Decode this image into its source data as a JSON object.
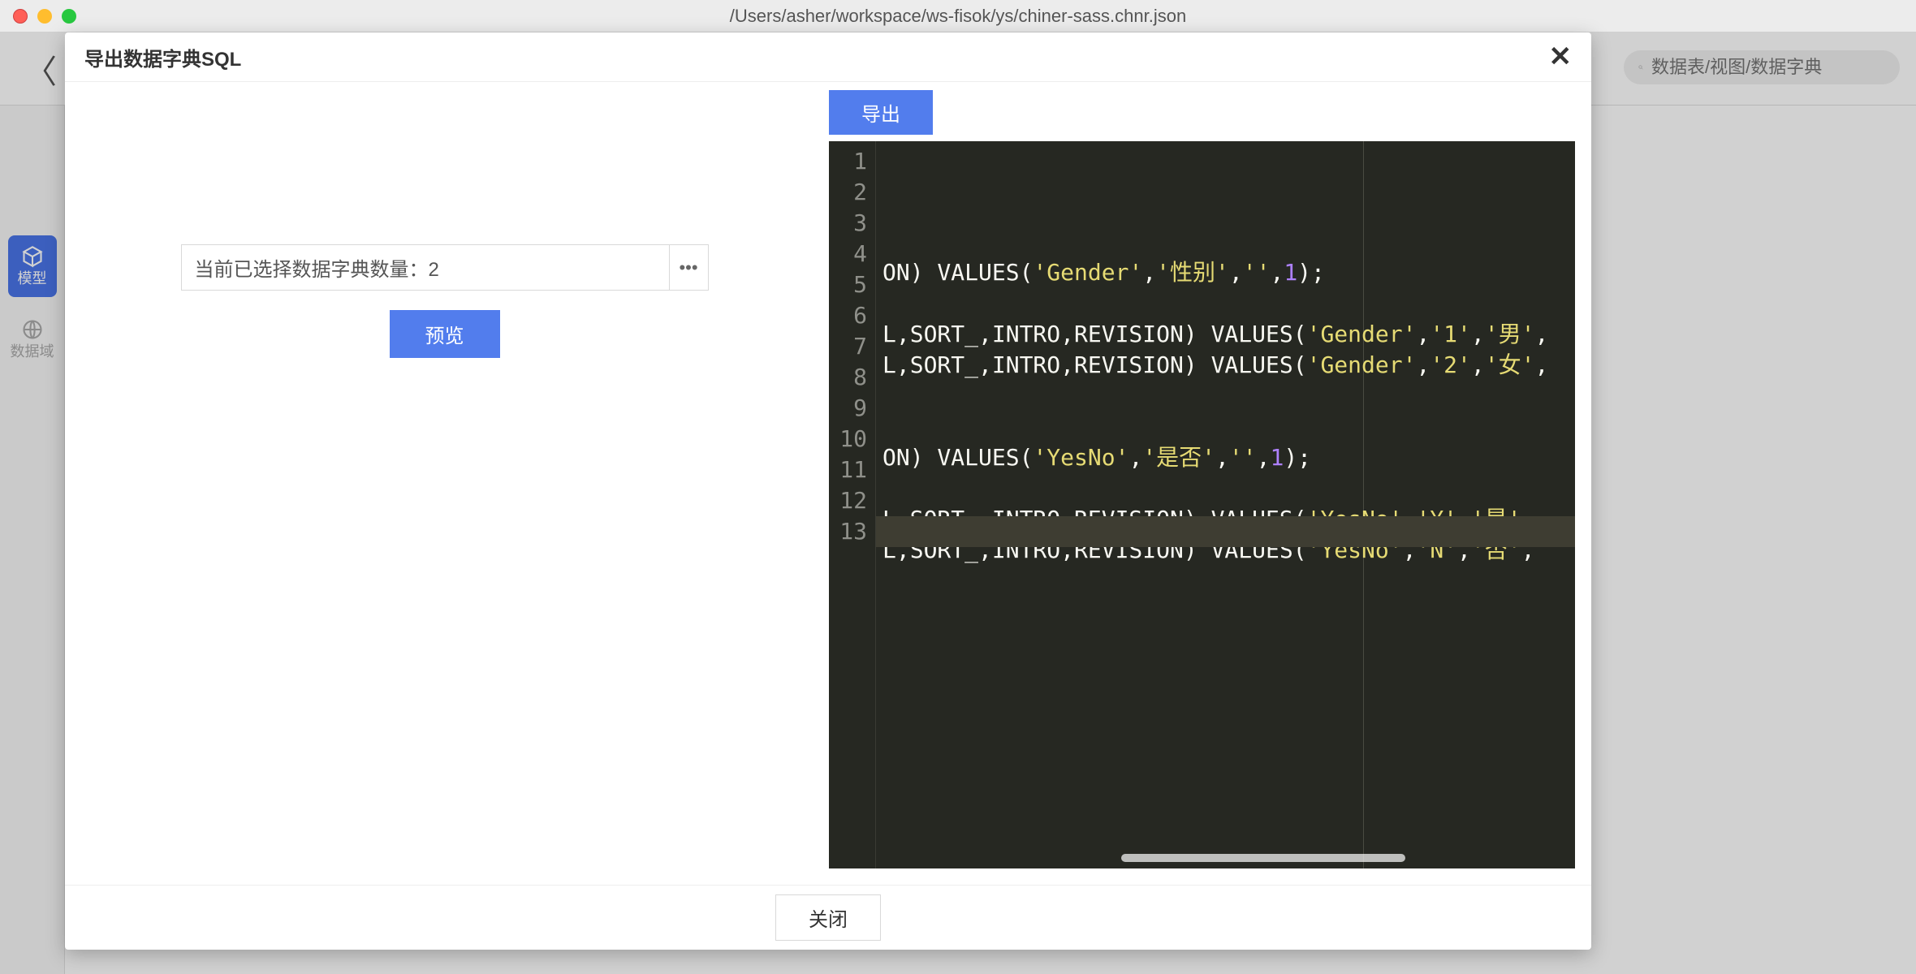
{
  "window": {
    "title": "/Users/asher/workspace/ws-fisok/ys/chiner-sass.chnr.json"
  },
  "toolbar": {
    "search_placeholder": "数据表/视图/数据字典"
  },
  "sidebar": {
    "items": [
      {
        "label": "模型"
      },
      {
        "label": "数据域"
      }
    ]
  },
  "modal": {
    "title": "导出数据字典SQL",
    "count_label": "当前已选择数据字典数量：",
    "count_value": "2",
    "preview_label": "预览",
    "export_label": "导出",
    "close_label": "关闭"
  },
  "code": {
    "current_line": 13,
    "lines": [
      {
        "n": 1,
        "segments": []
      },
      {
        "n": 2,
        "segments": [
          {
            "t": "ON) VALUES(",
            "c": "default"
          },
          {
            "t": "'Gender'",
            "c": "str"
          },
          {
            "t": ",",
            "c": "punc"
          },
          {
            "t": "'性别'",
            "c": "str"
          },
          {
            "t": ",",
            "c": "punc"
          },
          {
            "t": "''",
            "c": "str"
          },
          {
            "t": ",",
            "c": "punc"
          },
          {
            "t": "1",
            "c": "num"
          },
          {
            "t": ");",
            "c": "punc"
          }
        ]
      },
      {
        "n": 3,
        "segments": []
      },
      {
        "n": 4,
        "segments": [
          {
            "t": "L,SORT_,INTRO,REVISION) VALUES(",
            "c": "default"
          },
          {
            "t": "'Gender'",
            "c": "str"
          },
          {
            "t": ",",
            "c": "punc"
          },
          {
            "t": "'1'",
            "c": "str"
          },
          {
            "t": ",",
            "c": "punc"
          },
          {
            "t": "'男'",
            "c": "str"
          },
          {
            "t": ",",
            "c": "punc"
          }
        ]
      },
      {
        "n": 5,
        "segments": [
          {
            "t": "L,SORT_,INTRO,REVISION) VALUES(",
            "c": "default"
          },
          {
            "t": "'Gender'",
            "c": "str"
          },
          {
            "t": ",",
            "c": "punc"
          },
          {
            "t": "'2'",
            "c": "str"
          },
          {
            "t": ",",
            "c": "punc"
          },
          {
            "t": "'女'",
            "c": "str"
          },
          {
            "t": ",",
            "c": "punc"
          }
        ]
      },
      {
        "n": 6,
        "segments": []
      },
      {
        "n": 7,
        "segments": []
      },
      {
        "n": 8,
        "segments": [
          {
            "t": "ON) VALUES(",
            "c": "default"
          },
          {
            "t": "'YesNo'",
            "c": "str"
          },
          {
            "t": ",",
            "c": "punc"
          },
          {
            "t": "'是否'",
            "c": "str"
          },
          {
            "t": ",",
            "c": "punc"
          },
          {
            "t": "''",
            "c": "str"
          },
          {
            "t": ",",
            "c": "punc"
          },
          {
            "t": "1",
            "c": "num"
          },
          {
            "t": ");",
            "c": "punc"
          }
        ]
      },
      {
        "n": 9,
        "segments": []
      },
      {
        "n": 10,
        "segments": [
          {
            "t": "L,SORT_,INTRO,REVISION) VALUES(",
            "c": "default"
          },
          {
            "t": "'YesNo'",
            "c": "str"
          },
          {
            "t": ",",
            "c": "punc"
          },
          {
            "t": "'Y'",
            "c": "str"
          },
          {
            "t": ",",
            "c": "punc"
          },
          {
            "t": "'是'",
            "c": "str"
          },
          {
            "t": ",",
            "c": "punc"
          }
        ]
      },
      {
        "n": 11,
        "segments": [
          {
            "t": "L,SORT_,INTRO,REVISION) VALUES(",
            "c": "default"
          },
          {
            "t": "'YesNo'",
            "c": "str"
          },
          {
            "t": ",",
            "c": "punc"
          },
          {
            "t": "'N'",
            "c": "str"
          },
          {
            "t": ",",
            "c": "punc"
          },
          {
            "t": "'否'",
            "c": "str"
          },
          {
            "t": ",",
            "c": "punc"
          }
        ]
      },
      {
        "n": 12,
        "segments": []
      },
      {
        "n": 13,
        "segments": []
      }
    ]
  }
}
